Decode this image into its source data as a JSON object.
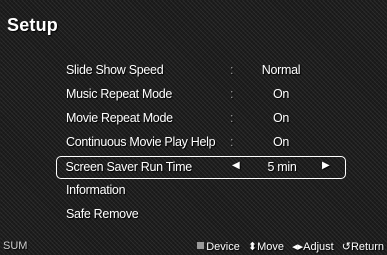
{
  "header": {
    "title": "Setup"
  },
  "menu": {
    "items": [
      {
        "label": "Slide Show Speed",
        "value": "Normal"
      },
      {
        "label": "Music Repeat Mode",
        "value": "On"
      },
      {
        "label": "Movie Repeat Mode",
        "value": "On"
      },
      {
        "label": "Continuous Movie Play Help",
        "value": "On"
      },
      {
        "label": "Screen Saver Run Time",
        "value": "5 min",
        "selected": true
      },
      {
        "label": "Information"
      },
      {
        "label": "Safe Remove"
      }
    ],
    "colon": ":",
    "left_arrow": "◀",
    "right_arrow": "▶"
  },
  "footer": {
    "source": "SUM",
    "device": "Device",
    "move_icon": "⬍",
    "move": "Move",
    "adjust_icon": "◂▸",
    "adjust": "Adjust",
    "return_icon": "↺",
    "return": "Return"
  }
}
